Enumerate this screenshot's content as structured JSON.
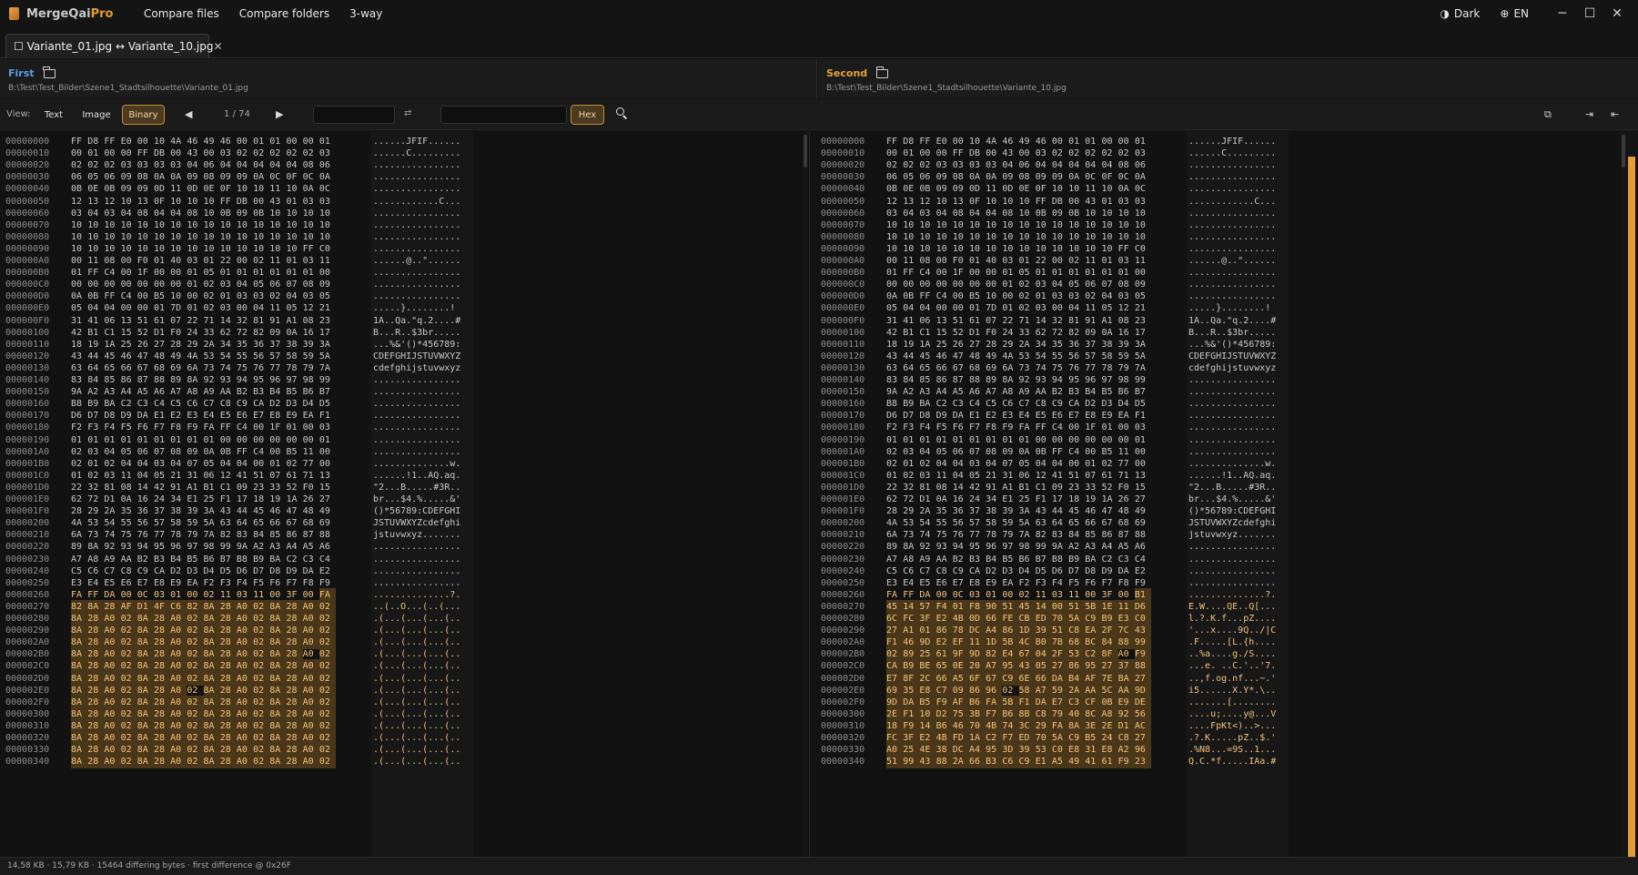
{
  "app": {
    "name_main": "MergeQai",
    "name_accent": "Pro"
  },
  "menu": [
    "Compare files",
    "Compare folders",
    "3-way"
  ],
  "title_right": {
    "theme": "Dark",
    "theme_glyph": "◑",
    "lang": "EN",
    "lang_glyph": "⊕"
  },
  "window_controls": {
    "minimize": "─",
    "maximize": "☐",
    "close": "✕"
  },
  "tab": {
    "label": "☐ Variante_01.jpg ↔ Variante_10.jpg",
    "close": "✕"
  },
  "left_header": {
    "label": "First",
    "path": "B:\\Test\\Test_Bilder\\Szene1_Stadtsilhouette\\Variante_01.jpg"
  },
  "right_header": {
    "label": "Second",
    "path": "B:\\Test\\Test_Bilder\\Szene1_Stadtsilhouette\\Variante_10.jpg"
  },
  "toolbar": {
    "view_label": "View:",
    "modes": [
      "Text",
      "Image",
      "Binary"
    ],
    "active_mode": "Binary",
    "prev": "◀",
    "next": "▶",
    "page": "1 / 74",
    "swap_glyph": "⇄",
    "hex_label": "Hex",
    "right_icons": [
      "⧉",
      "⇥",
      "⇤"
    ]
  },
  "left_rows": [
    [
      "00000000",
      "FF D8 FF E0 00 10 4A 46 49 46 00 01 01 00 00 01",
      "......JFIF......"
    ],
    [
      "00000010",
      "00 01 00 00 FF DB 00 43 00 03 02 02 02 02 02 03",
      "......C........."
    ],
    [
      "00000020",
      "02 02 02 03 03 03 03 04 06 04 04 04 04 04 08 06",
      "................"
    ],
    [
      "00000030",
      "06 05 06 09 08 0A 0A 09 08 09 09 0A 0C 0F 0C 0A",
      "................"
    ],
    [
      "00000040",
      "0B 0E 0B 09 09 0D 11 0D 0E 0F 10 10 11 10 0A 0C",
      "................"
    ],
    [
      "00000050",
      "12 13 12 10 13 0F 10 10 10 FF DB 00 43 01 03 03",
      "............C..."
    ],
    [
      "00000060",
      "03 04 03 04 08 04 04 08 10 0B 09 0B 10 10 10 10",
      "................"
    ],
    [
      "00000070",
      "10 10 10 10 10 10 10 10 10 10 10 10 10 10 10 10",
      "................"
    ],
    [
      "00000080",
      "10 10 10 10 10 10 10 10 10 10 10 10 10 10 10 10",
      "................"
    ],
    [
      "00000090",
      "10 10 10 10 10 10 10 10 10 10 10 10 10 10 FF C0",
      "................"
    ],
    [
      "000000A0",
      "00 11 08 00 F0 01 40 03 01 22 00 02 11 01 03 11",
      "......@..\"......"
    ],
    [
      "000000B0",
      "01 FF C4 00 1F 00 00 01 05 01 01 01 01 01 01 00",
      "................"
    ],
    [
      "000000C0",
      "00 00 00 00 00 00 00 01 02 03 04 05 06 07 08 09",
      "................"
    ],
    [
      "000000D0",
      "0A 0B FF C4 00 B5 10 00 02 01 03 03 02 04 03 05",
      "................"
    ],
    [
      "000000E0",
      "05 04 04 00 00 01 7D 01 02 03 00 04 11 05 12 21",
      ".....}........!"
    ],
    [
      "000000F0",
      "31 41 06 13 51 61 07 22 71 14 32 81 91 A1 08 23",
      "1A..Qa.\"q.2....#"
    ],
    [
      "00000100",
      "42 B1 C1 15 52 D1 F0 24 33 62 72 82 09 0A 16 17",
      "B...R..$3br....."
    ],
    [
      "00000110",
      "18 19 1A 25 26 27 28 29 2A 34 35 36 37 38 39 3A",
      "...%&'()*456789:"
    ],
    [
      "00000120",
      "43 44 45 46 47 48 49 4A 53 54 55 56 57 58 59 5A",
      "CDEFGHIJSTUVWXYZ"
    ],
    [
      "00000130",
      "63 64 65 66 67 68 69 6A 73 74 75 76 77 78 79 7A",
      "cdefghijstuvwxyz"
    ],
    [
      "00000140",
      "83 84 85 86 87 88 89 8A 92 93 94 95 96 97 98 99",
      "................"
    ],
    [
      "00000150",
      "9A A2 A3 A4 A5 A6 A7 A8 A9 AA B2 B3 B4 B5 B6 B7",
      "................"
    ],
    [
      "00000160",
      "B8 B9 BA C2 C3 C4 C5 C6 C7 C8 C9 CA D2 D3 D4 D5",
      "................"
    ],
    [
      "00000170",
      "D6 D7 D8 D9 DA E1 E2 E3 E4 E5 E6 E7 E8 E9 EA F1",
      "................"
    ],
    [
      "00000180",
      "F2 F3 F4 F5 F6 F7 F8 F9 FA FF C4 00 1F 01 00 03",
      "................"
    ],
    [
      "00000190",
      "01 01 01 01 01 01 01 01 01 00 00 00 00 00 00 01",
      "................"
    ],
    [
      "000001A0",
      "02 03 04 05 06 07 08 09 0A 0B FF C4 00 B5 11 00",
      "................"
    ],
    [
      "000001B0",
      "02 01 02 04 04 03 04 07 05 04 04 00 01 02 77 00",
      "..............w."
    ],
    [
      "000001C0",
      "01 02 03 11 04 05 21 31 06 12 41 51 07 61 71 13",
      "......!1..AQ.aq."
    ],
    [
      "000001D0",
      "22 32 81 08 14 42 91 A1 B1 C1 09 23 33 52 F0 15",
      "\"2...B.....#3R.."
    ],
    [
      "000001E0",
      "62 72 D1 0A 16 24 34 E1 25 F1 17 18 19 1A 26 27",
      "br...$4.%.....&'"
    ],
    [
      "000001F0",
      "28 29 2A 35 36 37 38 39 3A 43 44 45 46 47 48 49",
      "()*56789:CDEFGHI"
    ],
    [
      "00000200",
      "4A 53 54 55 56 57 58 59 5A 63 64 65 66 67 68 69",
      "JSTUVWXYZcdefghi"
    ],
    [
      "00000210",
      "6A 73 74 75 76 77 78 79 7A 82 83 84 85 86 87 88",
      "jstuvwxyz......."
    ],
    [
      "00000220",
      "89 8A 92 93 94 95 96 97 98 99 9A A2 A3 A4 A5 A6",
      "................"
    ],
    [
      "00000230",
      "A7 A8 A9 AA B2 B3 B4 B5 B6 B7 B8 B9 BA C2 C3 C4",
      "................"
    ],
    [
      "00000240",
      "C5 C6 C7 C8 C9 CA D2 D3 D4 D5 D6 D7 D8 D9 DA E2",
      "................"
    ],
    [
      "00000250",
      "E3 E4 E5 E6 E7 E8 E9 EA F2 F3 F4 F5 F6 F7 F8 F9",
      "................"
    ],
    [
      "00000260",
      "FA FF DA 00 0C 03 01 00 02 11 03 11 00 3F 00 FA",
      "..............?."
    ],
    [
      "00000270",
      "82 8A 28 AF D1 4F C6 82 8A 28 A0 02 8A 28 A0 02",
      "..(..O...(..(..."
    ],
    [
      "00000280",
      "8A 28 A0 02 8A 28 A0 02 8A 28 A0 02 8A 28 A0 02",
      ".(...(...(...(.."
    ],
    [
      "00000290",
      "8A 28 A0 02 8A 28 A0 02 8A 28 A0 02 8A 28 A0 02",
      ".(...(...(...(.."
    ],
    [
      "000002A0",
      "8A 28 A0 02 8A 28 A0 02 8A 28 A0 02 8A 28 A0 02",
      ".(...(...(...(.."
    ],
    [
      "000002B0",
      "8A 28 A0 02 8A 28 A0 02 8A 28 A0 02 8A 28 A0 02",
      ".(...(...(...(.."
    ],
    [
      "000002C0",
      "8A 28 A0 02 8A 28 A0 02 8A 28 A0 02 8A 28 A0 02",
      ".(...(...(...(.."
    ],
    [
      "000002D0",
      "8A 28 A0 02 8A 28 A0 02 8A 28 A0 02 8A 28 A0 02",
      ".(...(...(...(.."
    ],
    [
      "000002E0",
      "8A 28 A0 02 8A 28 A0 02 8A 28 A0 02 8A 28 A0 02",
      ".(...(...(...(.."
    ],
    [
      "000002F0",
      "8A 28 A0 02 8A 28 A0 02 8A 28 A0 02 8A 28 A0 02",
      ".(...(...(...(.."
    ],
    [
      "00000300",
      "8A 28 A0 02 8A 28 A0 02 8A 28 A0 02 8A 28 A0 02",
      ".(...(...(...(.."
    ],
    [
      "00000310",
      "8A 28 A0 02 8A 28 A0 02 8A 28 A0 02 8A 28 A0 02",
      ".(...(...(...(.."
    ],
    [
      "00000320",
      "8A 28 A0 02 8A 28 A0 02 8A 28 A0 02 8A 28 A0 02",
      ".(...(...(...(.."
    ],
    [
      "00000330",
      "8A 28 A0 02 8A 28 A0 02 8A 28 A0 02 8A 28 A0 02",
      ".(...(...(...(.."
    ],
    [
      "00000340",
      "8A 28 A0 02 8A 28 A0 02 8A 28 A0 02 8A 28 A0 02",
      ".(...(...(...(.."
    ]
  ],
  "right_rows": [
    [
      "00000000",
      "FF D8 FF E0 00 10 4A 46 49 46 00 01 01 00 00 01",
      "......JFIF......"
    ],
    [
      "00000010",
      "00 01 00 00 FF DB 00 43 00 03 02 02 02 02 02 03",
      "......C........."
    ],
    [
      "00000020",
      "02 02 02 03 03 03 03 04 06 04 04 04 04 04 08 06",
      "................"
    ],
    [
      "00000030",
      "06 05 06 09 08 0A 0A 09 08 09 09 0A 0C 0F 0C 0A",
      "................"
    ],
    [
      "00000040",
      "0B 0E 0B 09 09 0D 11 0D 0E 0F 10 10 11 10 0A 0C",
      "................"
    ],
    [
      "00000050",
      "12 13 12 10 13 0F 10 10 10 FF DB 00 43 01 03 03",
      "............C..."
    ],
    [
      "00000060",
      "03 04 03 04 08 04 04 08 10 0B 09 0B 10 10 10 10",
      "................"
    ],
    [
      "00000070",
      "10 10 10 10 10 10 10 10 10 10 10 10 10 10 10 10",
      "................"
    ],
    [
      "00000080",
      "10 10 10 10 10 10 10 10 10 10 10 10 10 10 10 10",
      "................"
    ],
    [
      "00000090",
      "10 10 10 10 10 10 10 10 10 10 10 10 10 10 FF C0",
      "................"
    ],
    [
      "000000A0",
      "00 11 08 00 F0 01 40 03 01 22 00 02 11 01 03 11",
      "......@..\"......"
    ],
    [
      "000000B0",
      "01 FF C4 00 1F 00 00 01 05 01 01 01 01 01 01 00",
      "................"
    ],
    [
      "000000C0",
      "00 00 00 00 00 00 00 01 02 03 04 05 06 07 08 09",
      "................"
    ],
    [
      "000000D0",
      "0A 0B FF C4 00 B5 10 00 02 01 03 03 02 04 03 05",
      "................"
    ],
    [
      "000000E0",
      "05 04 04 00 00 01 7D 01 02 03 00 04 11 05 12 21",
      ".....}........!"
    ],
    [
      "000000F0",
      "31 41 06 13 51 61 07 22 71 14 32 81 91 A1 08 23",
      "1A..Qa.\"q.2....#"
    ],
    [
      "00000100",
      "42 B1 C1 15 52 D1 F0 24 33 62 72 82 09 0A 16 17",
      "B...R..$3br....."
    ],
    [
      "00000110",
      "18 19 1A 25 26 27 28 29 2A 34 35 36 37 38 39 3A",
      "...%&'()*456789:"
    ],
    [
      "00000120",
      "43 44 45 46 47 48 49 4A 53 54 55 56 57 58 59 5A",
      "CDEFGHIJSTUVWXYZ"
    ],
    [
      "00000130",
      "63 64 65 66 67 68 69 6A 73 74 75 76 77 78 79 7A",
      "cdefghijstuvwxyz"
    ],
    [
      "00000140",
      "83 84 85 86 87 88 89 8A 92 93 94 95 96 97 98 99",
      "................"
    ],
    [
      "00000150",
      "9A A2 A3 A4 A5 A6 A7 A8 A9 AA B2 B3 B4 B5 B6 B7",
      "................"
    ],
    [
      "00000160",
      "B8 B9 BA C2 C3 C4 C5 C6 C7 C8 C9 CA D2 D3 D4 D5",
      "................"
    ],
    [
      "00000170",
      "D6 D7 D8 D9 DA E1 E2 E3 E4 E5 E6 E7 E8 E9 EA F1",
      "................"
    ],
    [
      "00000180",
      "F2 F3 F4 F5 F6 F7 F8 F9 FA FF C4 00 1F 01 00 03",
      "................"
    ],
    [
      "00000190",
      "01 01 01 01 01 01 01 01 01 00 00 00 00 00 00 01",
      "................"
    ],
    [
      "000001A0",
      "02 03 04 05 06 07 08 09 0A 0B FF C4 00 B5 11 00",
      "................"
    ],
    [
      "000001B0",
      "02 01 02 04 04 03 04 07 05 04 04 00 01 02 77 00",
      "..............w."
    ],
    [
      "000001C0",
      "01 02 03 11 04 05 21 31 06 12 41 51 07 61 71 13",
      "......!1..AQ.aq."
    ],
    [
      "000001D0",
      "22 32 81 08 14 42 91 A1 B1 C1 09 23 33 52 F0 15",
      "\"2...B.....#3R.."
    ],
    [
      "000001E0",
      "62 72 D1 0A 16 24 34 E1 25 F1 17 18 19 1A 26 27",
      "br...$4.%.....&'"
    ],
    [
      "000001F0",
      "28 29 2A 35 36 37 38 39 3A 43 44 45 46 47 48 49",
      "()*56789:CDEFGHI"
    ],
    [
      "00000200",
      "4A 53 54 55 56 57 58 59 5A 63 64 65 66 67 68 69",
      "JSTUVWXYZcdefghi"
    ],
    [
      "00000210",
      "6A 73 74 75 76 77 78 79 7A 82 83 84 85 86 87 88",
      "jstuvwxyz......."
    ],
    [
      "00000220",
      "89 8A 92 93 94 95 96 97 98 99 9A A2 A3 A4 A5 A6",
      "................"
    ],
    [
      "00000230",
      "A7 A8 A9 AA B2 B3 B4 B5 B6 B7 B8 B9 BA C2 C3 C4",
      "................"
    ],
    [
      "00000240",
      "C5 C6 C7 C8 C9 CA D2 D3 D4 D5 D6 D7 D8 D9 DA E2",
      "................"
    ],
    [
      "00000250",
      "E3 E4 E5 E6 E7 E8 E9 EA F2 F3 F4 F5 F6 F7 F8 F9",
      "................"
    ],
    [
      "00000260",
      "FA FF DA 00 0C 03 01 00 02 11 03 11 00 3F 00 B1",
      "..............?."
    ],
    [
      "00000270",
      "45 14 57 F4 01 F8 90 51 45 14 00 51 5B 1E 11 D6",
      "E.W....QE..Q[..."
    ],
    [
      "00000280",
      "6C FC 3F E2 4B 0D 66 FE CB ED 70 5A C9 B9 E3 C0",
      "l.?.K.f...pZ...."
    ],
    [
      "00000290",
      "27 A1 01 86 78 DC A4 86 1D 39 51 C8 EA 2F 7C 43",
      "'...x....9Q../|C"
    ],
    [
      "000002A0",
      "F1 46 9D E2 EF 11 1D 5B 4C B0 7B 68 BC 84 88 99",
      ".F.....[L.{h...."
    ],
    [
      "000002B0",
      "02 89 25 61 9F 9D 82 E4 67 04 2F 53 C2 8F A0 F9",
      "..%a....g./S...."
    ],
    [
      "000002C0",
      "CA B9 BE 65 0E 20 A7 95 43 05 27 86 95 27 37 88",
      "...e. ..C.'..'7."
    ],
    [
      "000002D0",
      "E7 8F 2C 66 A5 6F 67 C9 6E 66 DA B4 AF 7E BA 27",
      "..,f.og.nf...~.'"
    ],
    [
      "000002E0",
      "69 35 E8 C7 09 86 96 02 58 A7 59 2A AA 5C AA 9D",
      "i5......X.Y*.\\.."
    ],
    [
      "000002F0",
      "9D DA B5 F9 AF B6 FA 5B F1 DA E7 C3 CF 0B E9 DE",
      ".......[........"
    ],
    [
      "00000300",
      "2E F1 10 D2 75 3B F7 B6 8B C8 79 40 8C A8 92 56",
      "....u;....y@...V"
    ],
    [
      "00000310",
      "18 F9 14 B6 46 70 4B 74 3C 29 FA 8A 3E 2E D1 AC",
      "....FpKt<)..>..."
    ],
    [
      "00000320",
      "FC 3F E2 4B FD 1A C2 F7 ED 70 5A C9 B5 24 C8 27",
      ".?.K.....pZ..$.'"
    ],
    [
      "00000330",
      "A0 25 4E 38 DC A4 95 3D 39 53 C0 E8 31 E8 A2 96",
      ".%N8...=9S..1..."
    ],
    [
      "00000340",
      "51 99 43 88 2A 66 B3 C6 C9 E1 A5 49 41 61 F9 23",
      "Q.C.*f.....IAa.#"
    ]
  ],
  "diff_start_row": 38,
  "status": "14,58 KB · 15,79 KB · 15464 differing bytes  ·  first difference @ 0x26F",
  "colors": {
    "accent": "#e59c32",
    "first": "#5a9ee0",
    "second": "#e5a23a"
  }
}
